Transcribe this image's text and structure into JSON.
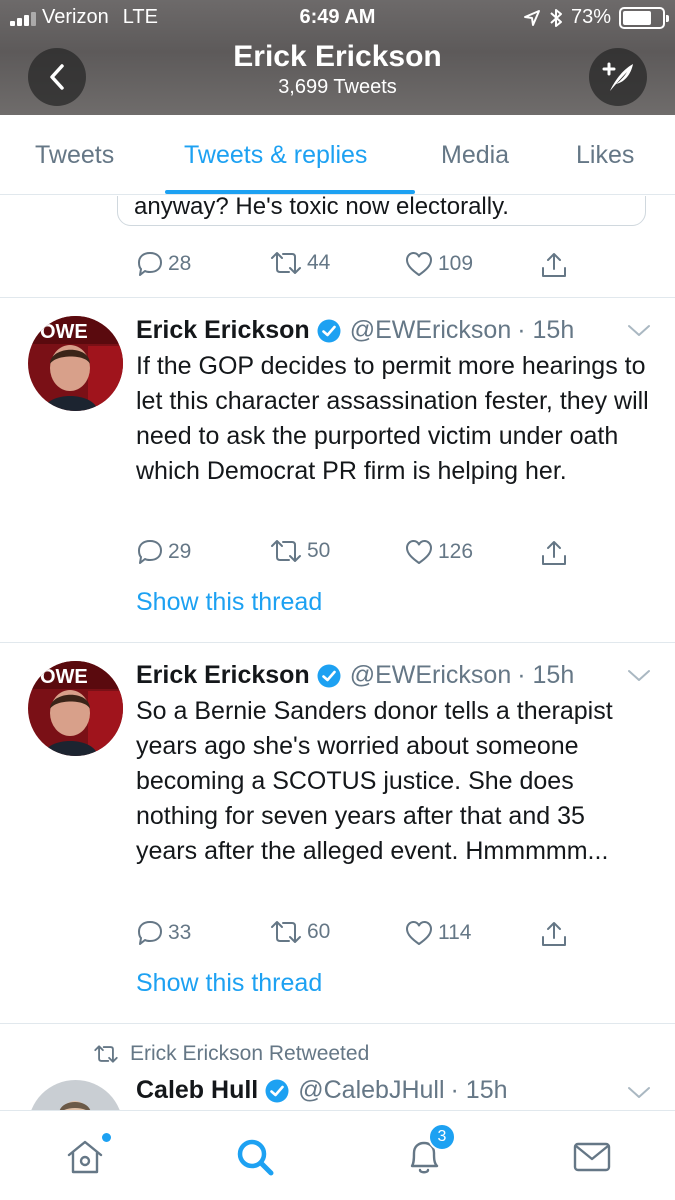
{
  "status_bar": {
    "carrier": "Verizon",
    "network": "LTE",
    "time": "6:49 AM",
    "battery": "73%",
    "battery_level": 0.73
  },
  "header": {
    "title": "Erick Erickson",
    "subtitle": "3,699 Tweets",
    "back_icon": "chevron-left-icon",
    "compose_icon": "compose-tweet-icon"
  },
  "tabs": [
    {
      "label": "Tweets",
      "active": false
    },
    {
      "label": "Tweets & replies",
      "active": true
    },
    {
      "label": "Media",
      "active": false
    },
    {
      "label": "Likes",
      "active": false
    }
  ],
  "quoted_partial": {
    "text": "anyway? He's toxic now electorally."
  },
  "first_actions": {
    "replies": "28",
    "retweets": "44",
    "likes": "109"
  },
  "tweets": [
    {
      "name": "Erick Erickson",
      "handle": "@EWErickson",
      "time": "· 15h",
      "text": "If the GOP decides to permit more hearings to let this character assassination fester, they will need to ask the purported victim under oath which Democrat PR firm is helping her.",
      "replies": "29",
      "retweets": "50",
      "likes": "126",
      "thread_link": "Show this thread"
    },
    {
      "name": "Erick Erickson",
      "handle": "@EWErickson",
      "time": "· 15h",
      "text": "So a Bernie Sanders donor tells a therapist years ago she's worried about someone becoming a SCOTUS justice. She does nothing for seven years after that and 35 years after the alleged event.  Hmmmmm...",
      "replies": "33",
      "retweets": "60",
      "likes": "114",
      "thread_link": "Show this thread"
    }
  ],
  "retweet": {
    "label": "Erick Erickson Retweeted",
    "name": "Caleb Hull",
    "handle": "@CalebJHull",
    "time": "· 15h"
  },
  "bottom_nav": {
    "notifications_badge": "3"
  },
  "colors": {
    "accent": "#1da1f2",
    "secondary_text": "#657786",
    "primary_text": "#14171a",
    "divider": "#e1e8ed",
    "verified": "#1da1f2"
  }
}
